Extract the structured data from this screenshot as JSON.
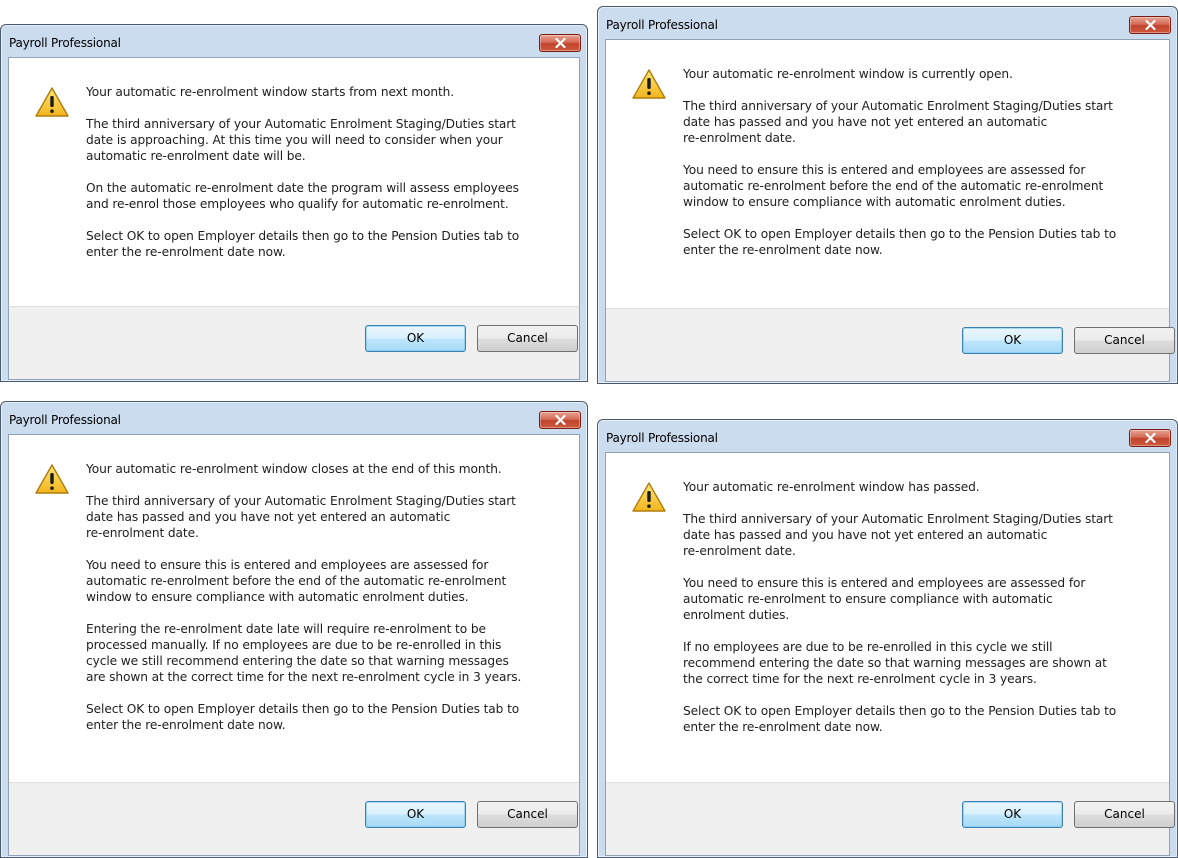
{
  "dialogs": [
    {
      "title": "Payroll Professional",
      "paragraphs": [
        "Your automatic re-enrolment window starts from next month.",
        "The third anniversary of your Automatic Enrolment Staging/Duties start\ndate  is approaching. At this time you will need to consider when your\nautomatic re-enrolment date will be.",
        "On the automatic re-enrolment date the program will assess employees\nand re-enrol those employees who qualify for automatic re-enrolment.",
        "Select OK to open Employer details then go to the Pension Duties tab to\nenter the re-enrolment date now."
      ],
      "ok_label": "OK",
      "cancel_label": "Cancel"
    },
    {
      "title": "Payroll Professional",
      "paragraphs": [
        "Your automatic re-enrolment window is currently open.",
        "The third anniversary of your Automatic Enrolment Staging/Duties start\ndate  has passed and you have not yet entered an automatic\nre-enrolment date.",
        "You need to ensure this is entered and employees are assessed for\nautomatic re-enrolment before the end of the automatic re-enrolment\nwindow to ensure compliance with automatic enrolment duties.",
        "Select OK to open Employer details then go to the Pension Duties tab to\nenter the re-enrolment date now."
      ],
      "ok_label": "OK",
      "cancel_label": "Cancel"
    },
    {
      "title": "Payroll Professional",
      "paragraphs": [
        "Your automatic re-enrolment window closes at the end of this month.",
        "The third anniversary of your Automatic Enrolment Staging/Duties start\ndate  has passed and you have not yet entered an automatic\nre-enrolment date.",
        "You need to ensure this is entered and employees are assessed for\nautomatic re-enrolment before the end of the automatic re-enrolment\nwindow to ensure compliance with automatic enrolment duties.",
        "Entering the re-enrolment date late will require re-enrolment to be\nprocessed manually. If no employees are due to be re-enrolled in this\ncycle we still recommend entering the date so that warning messages\nare shown at the correct time for the next re-enrolment cycle in 3 years.",
        "Select OK to open Employer details then go to the Pension Duties tab to\nenter the re-enrolment date now."
      ],
      "ok_label": "OK",
      "cancel_label": "Cancel"
    },
    {
      "title": "Payroll Professional",
      "paragraphs": [
        "Your automatic re-enrolment window has passed.",
        "The third anniversary of your Automatic Enrolment Staging/Duties start\ndate  has passed and you have not yet entered an automatic\nre-enrolment date.",
        "You need to ensure this is entered and employees are assessed for\nautomatic re-enrolment to ensure compliance with automatic\nenrolment duties.",
        "If no employees are due to be re-enrolled in this cycle we still\nrecommend entering the date so that warning messages are shown at\nthe correct time for the next re-enrolment cycle in 3 years.",
        "Select OK to open Employer details then go to the Pension Duties tab to\nenter the re-enrolment date now."
      ],
      "ok_label": "OK",
      "cancel_label": "Cancel"
    }
  ],
  "icons": {
    "warning": "warning-icon",
    "close": "close-icon"
  },
  "colors": {
    "close_button": "#c2432b",
    "ok_button_border": "#3c7fb1",
    "footer_bg": "#f0f0f0",
    "frame": "#cbdcef"
  }
}
